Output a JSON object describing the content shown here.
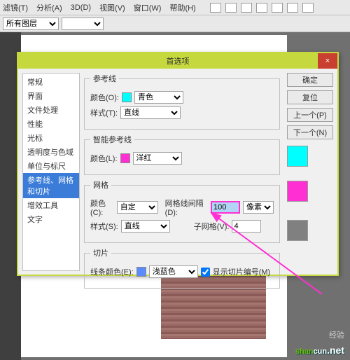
{
  "menubar": {
    "items": [
      "滤镜(T)",
      "分析(A)",
      "3D(D)",
      "视图(V)",
      "窗口(W)",
      "帮助(H)"
    ]
  },
  "toolbar": {
    "layerLabel": "所有图层"
  },
  "dialog": {
    "title": "首选项",
    "closeGlyph": "×",
    "sidebar": [
      "常规",
      "界面",
      "文件处理",
      "性能",
      "光标",
      "透明度与色域",
      "单位与标尺",
      "参考线、网格和切片",
      "增效工具",
      "文字"
    ],
    "selectedIndex": 7,
    "guides": {
      "legend": "参考线",
      "colorLabel": "颜色(O):",
      "colorValue": "青色",
      "styleLabel": "样式(T):",
      "styleValue": "直线"
    },
    "smartGuides": {
      "legend": "智能参考线",
      "colorLabel": "颜色(L):",
      "colorValue": "洋红"
    },
    "grid": {
      "legend": "网格",
      "colorLabel": "颜色(C):",
      "colorValue": "自定",
      "styleLabel": "样式(S):",
      "styleValue": "直线",
      "spacingLabel": "网格线间隔(D):",
      "spacingValue": "100",
      "unit": "像素",
      "subdivLabel": "子网格(V):",
      "subdivValue": "4"
    },
    "slices": {
      "legend": "切片",
      "colorLabel": "线条颜色(E):",
      "colorValue": "浅蓝色",
      "showNumLabel": "显示切片编号(M)"
    },
    "buttons": {
      "ok": "确定",
      "cancel": "复位",
      "prev": "上一个(P)",
      "next": "下一个(N)"
    }
  },
  "watermark": {
    "baidu": "经验",
    "site1": "shan",
    "site2": "cun",
    "net": ".net"
  }
}
